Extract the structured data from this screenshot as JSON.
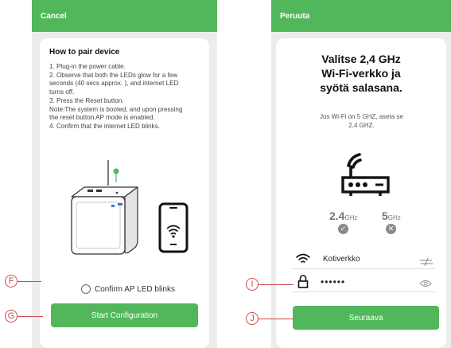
{
  "left_screen": {
    "topbar": {
      "cancel_label": "Cancel"
    },
    "title": "How to pair device",
    "steps": [
      "1. Plug-in the power cable.",
      "2. Observe that both the LEDs glow for a few",
      "seconds (40 secs approx. ), and internet LED",
      "turns off.",
      "3. Press the Reset button.",
      "Note:The system is booted, and upon pressing",
      "the reset button AP mode is enabled.",
      "4. Confirm that the internet LED blinks."
    ],
    "confirm_label": "Confirm AP LED blinks",
    "confirm_checked": false,
    "start_label": "Start Configuration",
    "illustration": {
      "device_icon": "router-hub-icon",
      "phone_icon": "phone-wifi-icon",
      "led_icon": "led-indicator-icon"
    }
  },
  "right_screen": {
    "topbar": {
      "cancel_label": "Peruuta"
    },
    "title_lines": [
      "Valitse 2,4 GHz",
      "Wi-Fi-verkko ja",
      "syötä salasana."
    ],
    "hint_lines": [
      "Jos Wi-Fi on 5 GHZ, aseta se",
      "2,4 GHZ."
    ],
    "router_icon": "router-icon",
    "bands": [
      {
        "value": "2.4",
        "unit": "GHz",
        "status": "supported",
        "status_icon": "check-icon"
      },
      {
        "value": "5",
        "unit": "GHz",
        "status": "unsupported",
        "status_icon": "close-icon"
      }
    ],
    "network_name": "Kotiverkko",
    "password_mask": "••••••",
    "next_label": "Seuraava"
  },
  "callouts": {
    "f": "F",
    "g": "G",
    "i": "I",
    "j": "J"
  },
  "colors": {
    "accent": "#52b75b",
    "callout": "#cf4a4a",
    "background": "#ececec",
    "card": "#ffffff"
  }
}
